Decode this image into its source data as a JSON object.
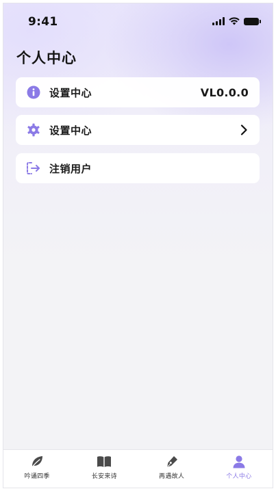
{
  "status_bar": {
    "time": "9:41"
  },
  "page": {
    "title": "个人中心"
  },
  "menu": [
    {
      "label": "设置中心",
      "value": "VL0.0.0",
      "icon": "info-icon"
    },
    {
      "label": "设置中心",
      "icon": "gear-icon",
      "trailing": "chevron-right-icon"
    },
    {
      "label": "注销用户",
      "icon": "logout-icon"
    }
  ],
  "tabbar": {
    "items": [
      {
        "label": "吟诵四季",
        "icon": "leaf-icon",
        "active": false
      },
      {
        "label": "长安来诗",
        "icon": "book-icon",
        "active": false
      },
      {
        "label": "再遇故人",
        "icon": "pen-icon",
        "active": false
      },
      {
        "label": "个人中心",
        "icon": "user-icon",
        "active": true
      }
    ]
  },
  "colors": {
    "accent": "#8b7ae6",
    "text": "#1a1a1a",
    "tab_inactive_icon": "#4a4a4a"
  }
}
